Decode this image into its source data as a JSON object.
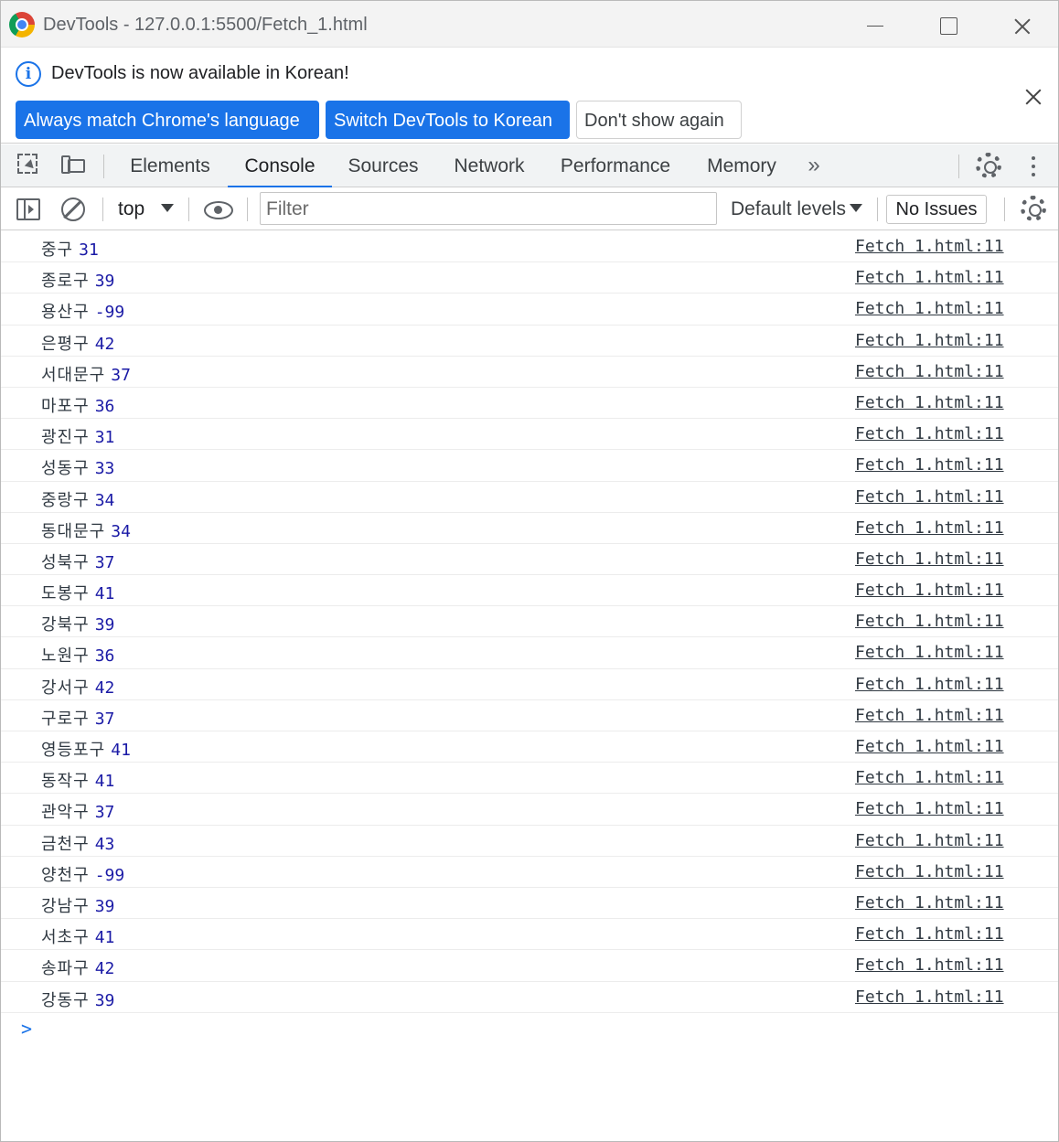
{
  "window": {
    "title": "DevTools - 127.0.0.1:5500/Fetch_1.html"
  },
  "infobar": {
    "message": "DevTools is now available in Korean!",
    "btn_always": "Always match Chrome's language",
    "btn_switch": "Switch DevTools to Korean",
    "btn_dont": "Don't show again"
  },
  "tabs": {
    "elements": "Elements",
    "console": "Console",
    "sources": "Sources",
    "network": "Network",
    "performance": "Performance",
    "memory": "Memory",
    "more": "»"
  },
  "console_toolbar": {
    "context": "top",
    "filter_placeholder": "Filter",
    "levels": "Default levels",
    "issues": "No Issues"
  },
  "logs": [
    {
      "district": "중구",
      "value": "31",
      "source": "Fetch 1.html:11"
    },
    {
      "district": "종로구",
      "value": "39",
      "source": "Fetch 1.html:11"
    },
    {
      "district": "용산구",
      "value": "-99",
      "source": "Fetch 1.html:11"
    },
    {
      "district": "은평구",
      "value": "42",
      "source": "Fetch 1.html:11"
    },
    {
      "district": "서대문구",
      "value": "37",
      "source": "Fetch 1.html:11"
    },
    {
      "district": "마포구",
      "value": "36",
      "source": "Fetch 1.html:11"
    },
    {
      "district": "광진구",
      "value": "31",
      "source": "Fetch 1.html:11"
    },
    {
      "district": "성동구",
      "value": "33",
      "source": "Fetch 1.html:11"
    },
    {
      "district": "중랑구",
      "value": "34",
      "source": "Fetch 1.html:11"
    },
    {
      "district": "동대문구",
      "value": "34",
      "source": "Fetch 1.html:11"
    },
    {
      "district": "성북구",
      "value": "37",
      "source": "Fetch 1.html:11"
    },
    {
      "district": "도봉구",
      "value": "41",
      "source": "Fetch 1.html:11"
    },
    {
      "district": "강북구",
      "value": "39",
      "source": "Fetch 1.html:11"
    },
    {
      "district": "노원구",
      "value": "36",
      "source": "Fetch 1.html:11"
    },
    {
      "district": "강서구",
      "value": "42",
      "source": "Fetch 1.html:11"
    },
    {
      "district": "구로구",
      "value": "37",
      "source": "Fetch 1.html:11"
    },
    {
      "district": "영등포구",
      "value": "41",
      "source": "Fetch 1.html:11"
    },
    {
      "district": "동작구",
      "value": "41",
      "source": "Fetch 1.html:11"
    },
    {
      "district": "관악구",
      "value": "37",
      "source": "Fetch 1.html:11"
    },
    {
      "district": "금천구",
      "value": "43",
      "source": "Fetch 1.html:11"
    },
    {
      "district": "양천구",
      "value": "-99",
      "source": "Fetch 1.html:11"
    },
    {
      "district": "강남구",
      "value": "39",
      "source": "Fetch 1.html:11"
    },
    {
      "district": "서초구",
      "value": "41",
      "source": "Fetch 1.html:11"
    },
    {
      "district": "송파구",
      "value": "42",
      "source": "Fetch 1.html:11"
    },
    {
      "district": "강동구",
      "value": "39",
      "source": "Fetch 1.html:11"
    }
  ],
  "prompt_symbol": ">",
  "colors": {
    "accent": "#1a73e8",
    "log_number": "#1a1aa6"
  }
}
